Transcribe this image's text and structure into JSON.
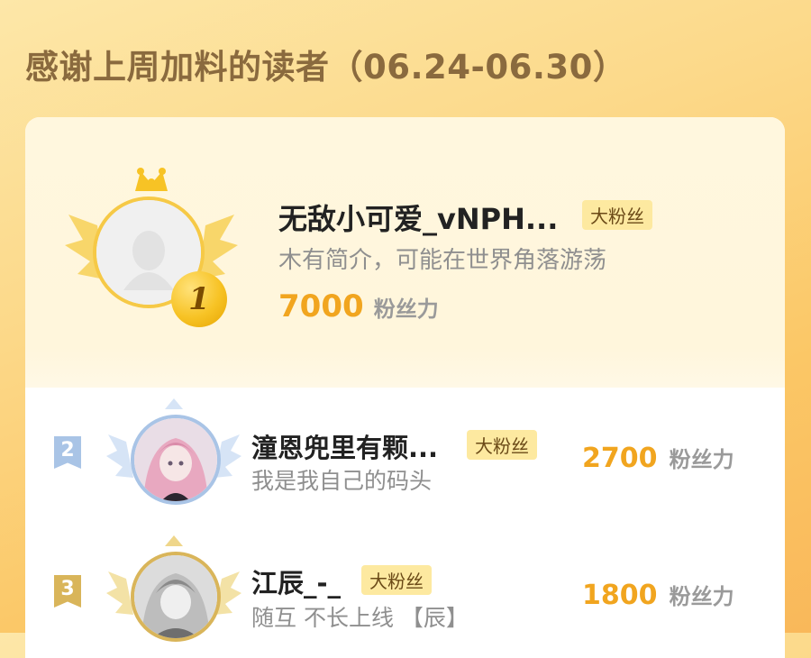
{
  "header": {
    "title": "感谢上周加料的读者（06.24-06.30）"
  },
  "colors": {
    "accent": "#f1a51f",
    "badge_bg": "#fde9a0",
    "gold": "#f7c325",
    "silver": "#a9c4e6",
    "bronze": "#d9b55a"
  },
  "top_reader": {
    "rank": "1",
    "name": "无敌小可爱_vNPH...",
    "badge": "大粉丝",
    "bio": "木有简介，可能在世界角落游荡",
    "score": "7000",
    "score_unit": "粉丝力"
  },
  "readers": [
    {
      "rank": "2",
      "name": "潼恩兜里有颗...",
      "badge": "大粉丝",
      "bio": "我是我自己的码头",
      "score": "2700",
      "score_unit": "粉丝力"
    },
    {
      "rank": "3",
      "name": "江辰_-_",
      "badge": "大粉丝",
      "bio": "随互 不长上线 【辰】",
      "score": "1800",
      "score_unit": "粉丝力"
    }
  ]
}
